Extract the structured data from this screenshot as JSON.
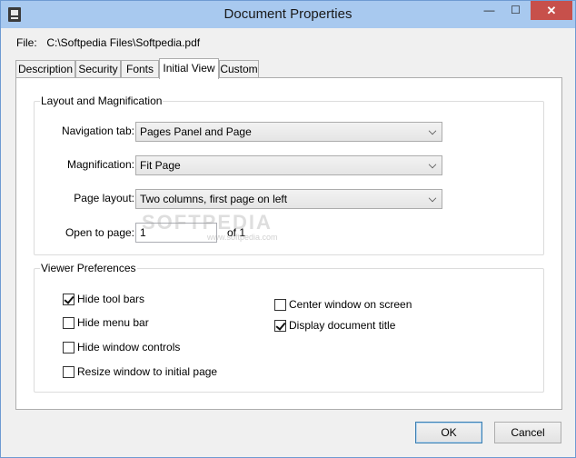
{
  "window": {
    "title": "Document Properties",
    "minimize_glyph": "—",
    "maximize_glyph": "☐",
    "close_glyph": "✕"
  },
  "file": {
    "label": "File:",
    "path": "C:\\Softpedia Files\\Softpedia.pdf"
  },
  "tabs": [
    {
      "label": "Description",
      "active": false
    },
    {
      "label": "Security",
      "active": false
    },
    {
      "label": "Fonts",
      "active": false
    },
    {
      "label": "Initial View",
      "active": true
    },
    {
      "label": "Custom",
      "active": false
    }
  ],
  "layout_group": {
    "title": "Layout and Magnification",
    "navigation_tab": {
      "label": "Navigation tab:",
      "value": "Pages Panel and Page"
    },
    "magnification": {
      "label": "Magnification:",
      "value": "Fit Page"
    },
    "page_layout": {
      "label": "Page layout:",
      "value": "Two columns, first page on left"
    },
    "open_to_page": {
      "label": "Open to page:",
      "value": "1",
      "of_text": "of 1"
    }
  },
  "viewer_group": {
    "title": "Viewer Preferences",
    "options": [
      {
        "label": "Hide tool bars",
        "checked": true
      },
      {
        "label": "Hide menu bar",
        "checked": false
      },
      {
        "label": "Hide window controls",
        "checked": false
      },
      {
        "label": "Resize window to initial page",
        "checked": false
      },
      {
        "label": "Center window on screen",
        "checked": false
      },
      {
        "label": "Display document title",
        "checked": true
      }
    ]
  },
  "buttons": {
    "ok": "OK",
    "cancel": "Cancel"
  },
  "watermark": {
    "main": "SOFTPEDIA",
    "sub": "www.softpedia.com"
  },
  "colors": {
    "titlebar": "#a8c9ef",
    "close_button": "#c7504b",
    "window_bg": "#f0f0f0",
    "panel_bg": "#ffffff"
  }
}
